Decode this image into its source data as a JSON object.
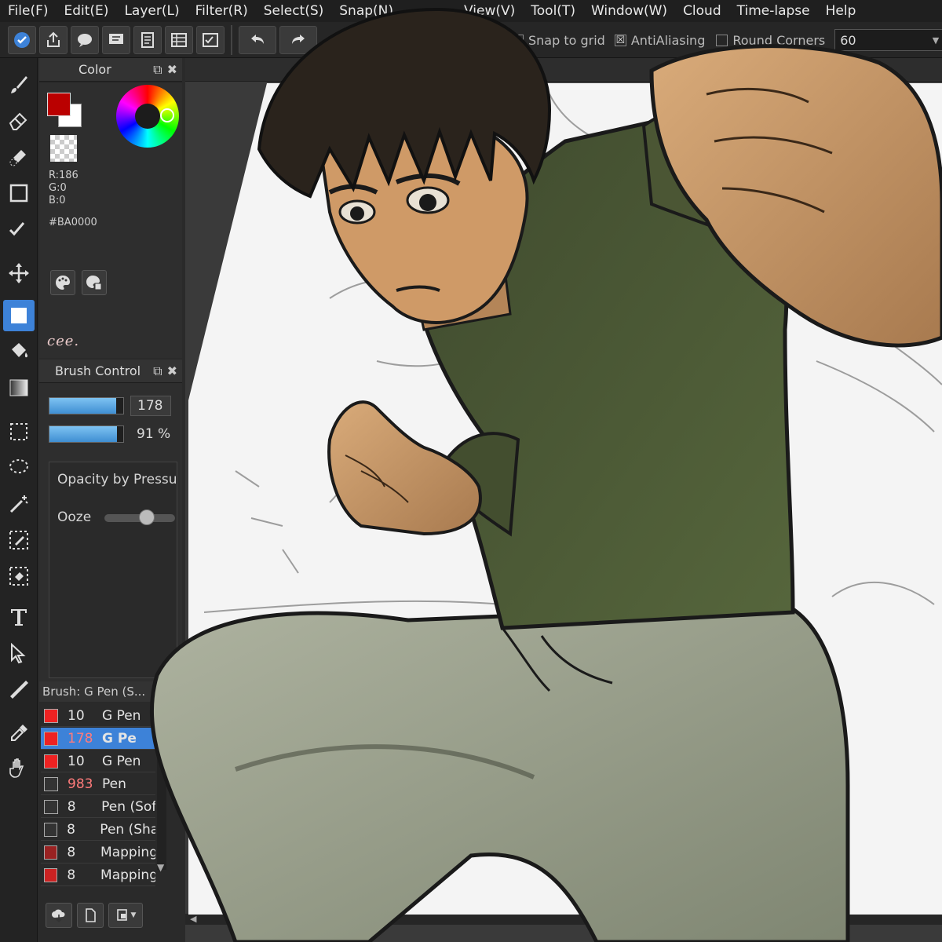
{
  "menu": [
    "File(F)",
    "Edit(E)",
    "Layer(L)",
    "Filter(R)",
    "Select(S)",
    "Snap(N)",
    "",
    "View(V)",
    "Tool(T)",
    "Window(W)",
    "Cloud",
    "Time-lapse",
    "Help"
  ],
  "toolbar": {
    "snap_to_grid": "Snap to grid",
    "antialiasing": "AntiAliasing",
    "round_corners": "Round Corners",
    "round_value": "60",
    "percent": "%",
    "antialiasing_checked": "☒"
  },
  "color_panel": {
    "title": "Color",
    "fg_color": "#BA0000",
    "bg_color": "#FFFFFF",
    "r": "R:186",
    "g": "G:0",
    "b": "B:0",
    "hex": "#BA0000",
    "signature": "cee."
  },
  "brush_control": {
    "title": "Brush Control",
    "size_value": "178",
    "size_fraction": 0.9,
    "opacity_value": "91 %",
    "opacity_fraction": 0.91,
    "opacity_by_pressure": "Opacity by Pressu",
    "ooze": "Ooze"
  },
  "brush_list": {
    "title": "Brush: G Pen (S...",
    "rows": [
      {
        "size": "10",
        "name": "G Pen",
        "color": "#ee2222",
        "selected": false
      },
      {
        "size": "178",
        "name": "G Pe",
        "color": "#ee2222",
        "selected": true
      },
      {
        "size": "10",
        "name": "G Pen",
        "color": "#ee2222",
        "selected": false
      },
      {
        "size": "983",
        "name": "Pen",
        "color": "#333333",
        "selected": false
      },
      {
        "size": "8",
        "name": "Pen (Sof",
        "color": "#333333",
        "selected": false
      },
      {
        "size": "8",
        "name": "Pen (Sha",
        "color": "#333333",
        "selected": false
      },
      {
        "size": "8",
        "name": "Mapping",
        "color": "#992222",
        "selected": false
      },
      {
        "size": "8",
        "name": "Mapping",
        "color": "#cc2222",
        "selected": false
      }
    ]
  },
  "icons": {
    "toolbar": [
      "check-badge-icon",
      "share-icon",
      "chat-bubble-icon",
      "comment-icon",
      "document-icon",
      "table-icon",
      "checklist-icon",
      "undo-icon",
      "redo-icon"
    ],
    "tools": [
      "brush-icon",
      "eraser-icon",
      "blur-icon",
      "shape-rect-icon",
      "pen-check-icon",
      "move-icon",
      "fill-rect-icon",
      "bucket-icon",
      "gradient-icon",
      "select-rect-icon",
      "lasso-icon",
      "magic-wand-icon",
      "select-pen-icon",
      "select-eraser-icon",
      "text-icon",
      "operation-icon",
      "divide-icon",
      "eyedropper-icon",
      "hand-icon"
    ]
  },
  "colors": {
    "accent": "#3d82d8",
    "shirt": "#4a5a34",
    "pants": "#9aa08a",
    "skin": "#c89a6a",
    "hair": "#2a231c"
  }
}
